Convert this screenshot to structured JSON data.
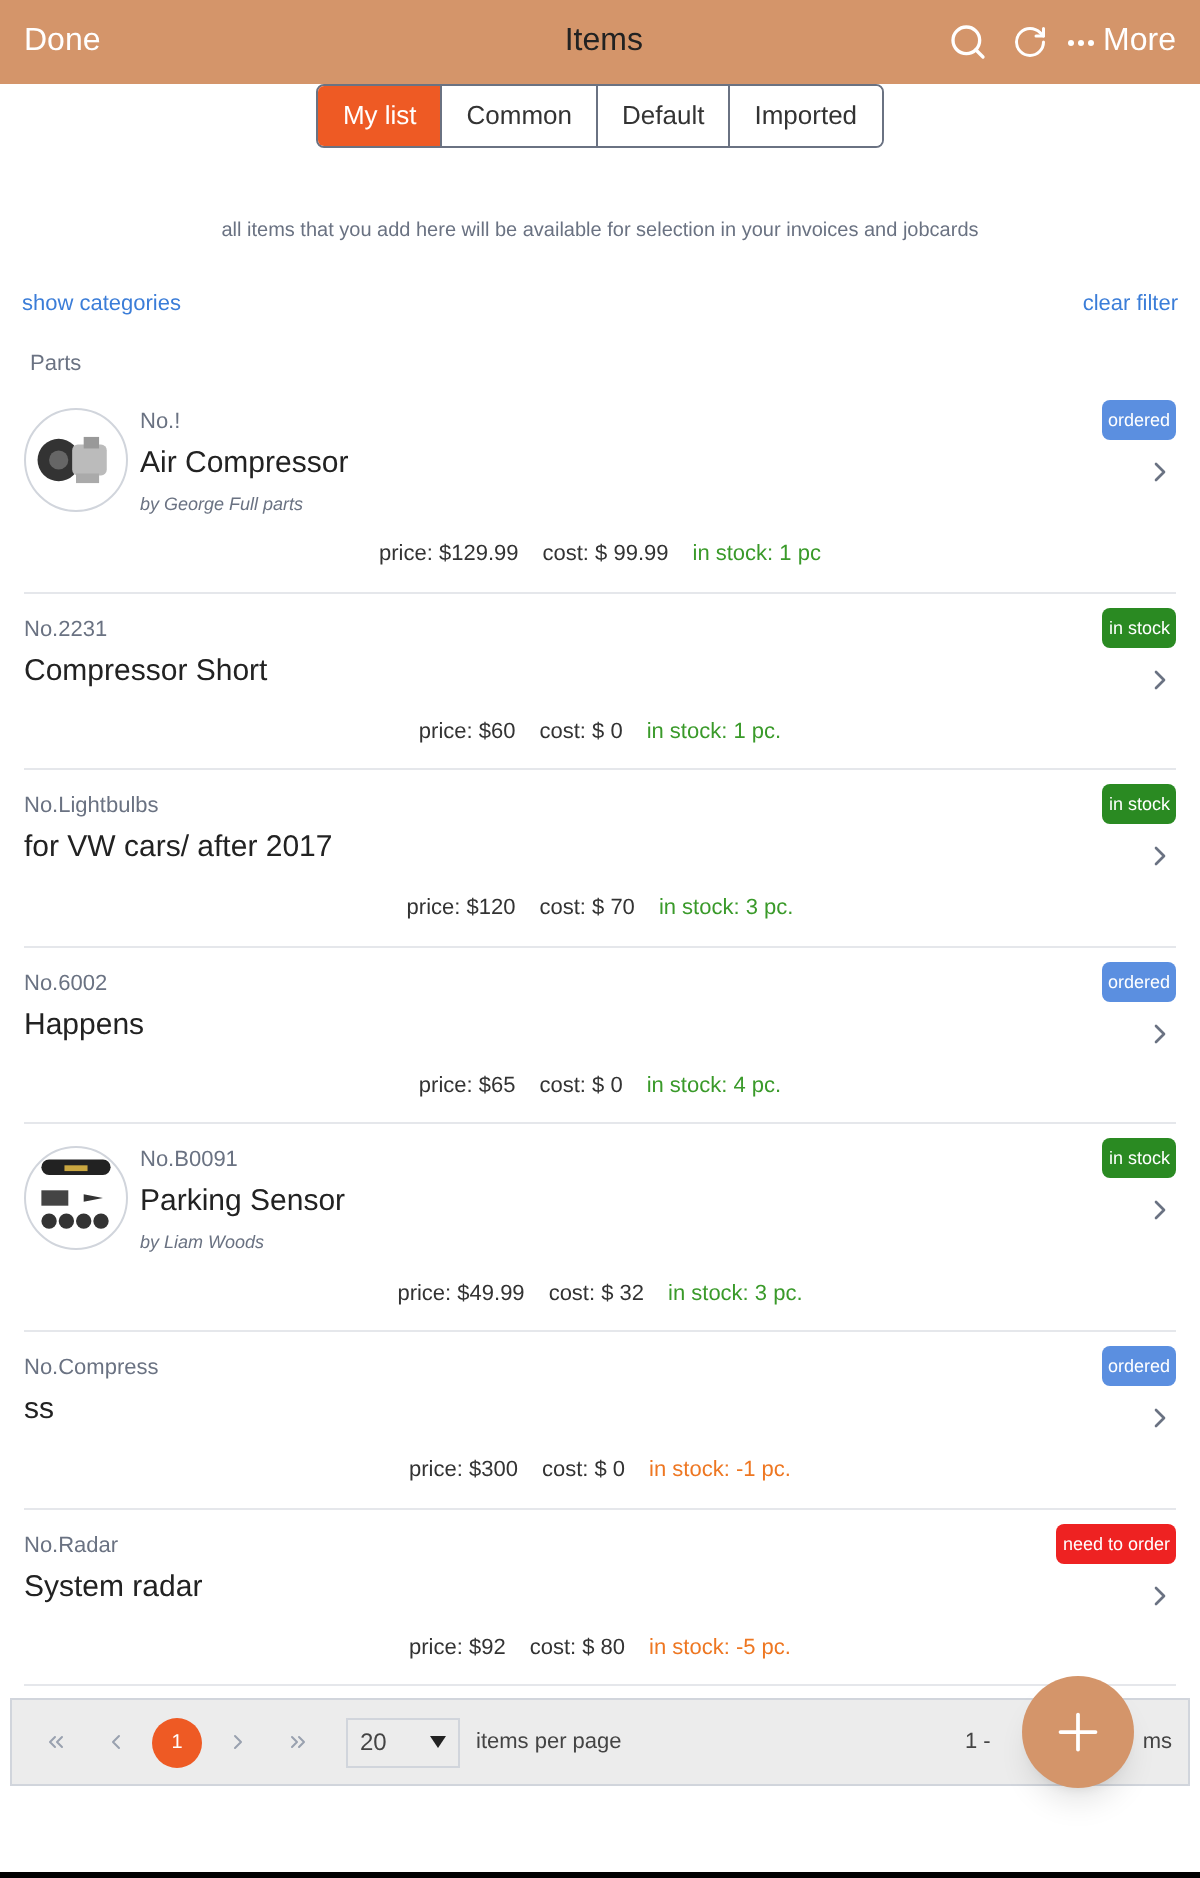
{
  "header": {
    "done": "Done",
    "title": "Items",
    "more": "More"
  },
  "tabs": [
    {
      "label": "My list",
      "selected": true
    },
    {
      "label": "Common",
      "selected": false
    },
    {
      "label": "Default",
      "selected": false
    },
    {
      "label": "Imported",
      "selected": false
    }
  ],
  "description": "all items that you add here will be available for selection in your invoices and jobcards",
  "show_categories": "show categories",
  "clear_filter": "clear filter",
  "section": "Parts",
  "items": [
    {
      "number": "No.!",
      "name": "Air Compressor",
      "author": "by George Full parts",
      "badge": {
        "label": "ordered",
        "color": "#5b8fe0"
      },
      "price": "price: $129.99",
      "cost": "cost: $ 99.99",
      "stock": {
        "text": "in stock: 1 pc",
        "color": "#3a9a2a"
      }
    },
    {
      "number": "No.2231",
      "name": "Compressor Short",
      "badge": {
        "label": "in stock",
        "color": "#2a8a22"
      },
      "price": "price: $60",
      "cost": "cost: $ 0",
      "stock": {
        "text": "in stock: 1 pc.",
        "color": "#3a9a2a"
      }
    },
    {
      "number": "No.Lightbulbs",
      "name": "for VW cars/ after 2017",
      "badge": {
        "label": "in stock",
        "color": "#2a8a22"
      },
      "price": "price: $120",
      "cost": "cost: $ 70",
      "stock": {
        "text": "in stock: 3 pc.",
        "color": "#3a9a2a"
      }
    },
    {
      "number": "No.6002",
      "name": "Happens",
      "badge": {
        "label": "ordered",
        "color": "#5b8fe0"
      },
      "price": "price: $65",
      "cost": "cost: $ 0",
      "stock": {
        "text": "in stock: 4 pc.",
        "color": "#3a9a2a"
      }
    },
    {
      "number": "No.B0091",
      "name": "Parking Sensor",
      "author": "by Liam Woods",
      "badge": {
        "label": "in stock",
        "color": "#2a8a22"
      },
      "price": "price: $49.99",
      "cost": "cost: $ 32",
      "stock": {
        "text": "in stock: 3 pc.",
        "color": "#3a9a2a"
      }
    },
    {
      "number": "No.Compress",
      "name": "ss",
      "badge": {
        "label": "ordered",
        "color": "#5b8fe0"
      },
      "price": "price: $300",
      "cost": "cost: $ 0",
      "stock": {
        "text": "in stock: -1 pc.",
        "color": "#ee7722"
      }
    },
    {
      "number": "No.Radar",
      "name": "System radar",
      "badge": {
        "label": "need to order",
        "color": "#ee2222"
      },
      "price": "price: $92",
      "cost": "cost: $ 80",
      "stock": {
        "text": "in stock: -5 pc.",
        "color": "#ee7722"
      }
    }
  ],
  "pager": {
    "pages": [
      {
        "label": "1",
        "selected": true
      }
    ],
    "per_page": "20",
    "per_page_label": "items per page",
    "range_start": "1 -",
    "range_end": "ms"
  }
}
